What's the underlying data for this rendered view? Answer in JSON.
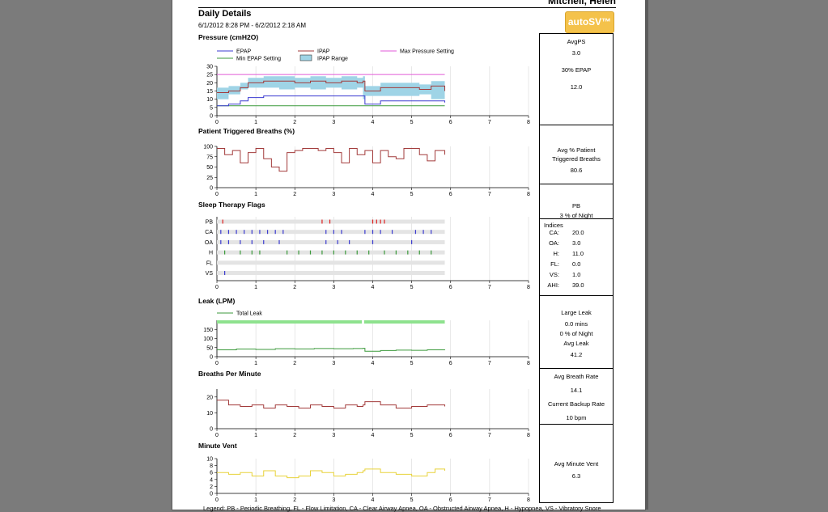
{
  "header": {
    "patient_name": "Mitchell, Helen",
    "title": "Daily Details",
    "date_range": "6/1/2012 8:28 PM - 6/2/2012 2:18 AM",
    "logo_text": "autoSV™"
  },
  "colors": {
    "epap": "#3b3bd0",
    "ipap": "#a23b3b",
    "min_epap": "#3c9a3c",
    "max_pressure": "#e05ad8",
    "ipap_range": "#9fd4e6",
    "flag_pb": "#e02020",
    "flag_ca": "#3b3bd0",
    "flag_oa": "#3b3bd0",
    "flag_h": "#3c9a3c",
    "leak": "#3c9a3c",
    "leak_bar": "#8ee28e",
    "breaths": "#a23b3b",
    "minute_vent": "#e8d23a"
  },
  "sections": {
    "pressure": "Pressure (cmH2O)",
    "triggered": "Patient Triggered Breaths (%)",
    "flags": "Sleep Therapy Flags",
    "leak": "Leak (LPM)",
    "bpm": "Breaths Per Minute",
    "mv": "Minute Vent"
  },
  "side": {
    "pressure": {
      "l1": "AvgPS",
      "v1": "3.0",
      "l2": "30% EPAP",
      "v2": "12.0"
    },
    "triggered": {
      "l1": "Avg % Patient",
      "l2": "Triggered Breaths",
      "v1": "80.6"
    },
    "pb": {
      "l1": "PB",
      "v1": "3 % of Night"
    },
    "indices": {
      "title": "Indices",
      "rows": [
        {
          "k": "CA:",
          "v": "20.0"
        },
        {
          "k": "OA:",
          "v": "3.0"
        },
        {
          "k": "H:",
          "v": "11.0"
        },
        {
          "k": "FL:",
          "v": "0.0"
        },
        {
          "k": "VS:",
          "v": "1.0"
        },
        {
          "k": "AHI:",
          "v": "39.0"
        }
      ]
    },
    "leak": {
      "l1": "Large Leak",
      "v1": "0.0 mins",
      "v2": "0 % of Night",
      "l2": "Avg Leak",
      "v3": "41.2"
    },
    "bpm": {
      "l1": "Avg Breath Rate",
      "v1": "14.1",
      "l2": "Current Backup Rate",
      "v2": "10 bpm"
    },
    "mv": {
      "l1": "Avg Minute Vent",
      "v1": "6.3"
    }
  },
  "footer": "Legend: PB - Periodic Breathing, FL - Flow Limitation, CA - Clear Airway Apnea, OA - Obstructed Airway Apnea, H - Hypopnea, VS - Vibratory Snore",
  "chart_data": [
    {
      "type": "line",
      "title": "Pressure (cmH2O)",
      "x_ticks": [
        "0",
        "1",
        "2",
        "3",
        "4",
        "5",
        "6",
        "7",
        "8"
      ],
      "y_ticks": [
        "0",
        "5",
        "10",
        "15",
        "20",
        "25",
        "30"
      ],
      "xlim": [
        0,
        8
      ],
      "ylim": [
        0,
        30
      ],
      "legend": [
        "EPAP",
        "IPAP",
        "Max Pressure Setting",
        "Min EPAP Setting",
        "IPAP Range"
      ],
      "series": [
        {
          "name": "Max Pressure Setting",
          "x": [
            0,
            5.85
          ],
          "y": [
            25,
            25
          ]
        },
        {
          "name": "Min EPAP Setting",
          "x": [
            0,
            5.85
          ],
          "y": [
            6,
            6
          ]
        },
        {
          "name": "IPAP",
          "x": [
            0,
            0.3,
            0.6,
            0.8,
            1.2,
            1.6,
            2.0,
            2.4,
            2.8,
            3.2,
            3.6,
            3.75,
            3.8,
            4.2,
            4.8,
            5.2,
            5.5,
            5.85
          ],
          "y": [
            14,
            15,
            17,
            20,
            21,
            21,
            20,
            21,
            20,
            21,
            20,
            21,
            15,
            17,
            17,
            16,
            18,
            15
          ]
        },
        {
          "name": "EPAP",
          "x": [
            0,
            0.3,
            0.6,
            0.8,
            1.2,
            1.6,
            2.0,
            2.4,
            2.8,
            3.2,
            3.6,
            3.75,
            3.8,
            4.2,
            4.8,
            5.2,
            5.5,
            5.85
          ],
          "y": [
            6,
            7,
            9,
            11,
            12,
            12,
            12,
            12,
            12,
            12,
            12,
            12,
            7,
            9,
            9,
            9,
            9,
            8
          ]
        }
      ],
      "range_band": {
        "name": "IPAP Range",
        "x": [
          0,
          0.3,
          0.6,
          0.8,
          1.2,
          1.6,
          2.0,
          2.4,
          2.8,
          3.2,
          3.6,
          3.75,
          3.8,
          4.2,
          4.8,
          5.2,
          5.5,
          5.85
        ],
        "low": [
          9,
          10,
          13,
          16,
          17,
          17,
          16,
          17,
          16,
          17,
          16,
          17,
          10,
          12,
          12,
          12,
          13,
          10
        ],
        "high": [
          17,
          18,
          20,
          23,
          24,
          24,
          23,
          24,
          23,
          24,
          23,
          24,
          18,
          20,
          20,
          19,
          21,
          18
        ]
      }
    },
    {
      "type": "line",
      "title": "Patient Triggered Breaths (%)",
      "x_ticks": [
        "0",
        "1",
        "2",
        "3",
        "4",
        "5",
        "6",
        "7",
        "8"
      ],
      "y_ticks": [
        "0",
        "25",
        "50",
        "75",
        "100"
      ],
      "xlim": [
        0,
        8
      ],
      "ylim": [
        0,
        100
      ],
      "series": [
        {
          "name": "Patient Triggered Breaths",
          "x": [
            0,
            0.2,
            0.4,
            0.6,
            0.8,
            1.0,
            1.2,
            1.4,
            1.6,
            1.8,
            2.0,
            2.2,
            2.4,
            2.6,
            2.8,
            3.0,
            3.2,
            3.4,
            3.6,
            3.8,
            4.0,
            4.2,
            4.4,
            4.6,
            4.8,
            5.0,
            5.2,
            5.4,
            5.6,
            5.85
          ],
          "y": [
            95,
            80,
            90,
            60,
            85,
            95,
            70,
            50,
            40,
            85,
            90,
            95,
            95,
            90,
            95,
            85,
            60,
            95,
            80,
            90,
            60,
            90,
            75,
            70,
            95,
            95,
            80,
            65,
            90,
            80
          ]
        }
      ]
    },
    {
      "type": "scatter",
      "title": "Sleep Therapy Flags",
      "x_ticks": [
        "0",
        "1",
        "2",
        "3",
        "4",
        "5",
        "6",
        "7",
        "8"
      ],
      "categories": [
        "PB",
        "CA",
        "OA",
        "H",
        "FL",
        "VS"
      ],
      "xlim": [
        0,
        8
      ],
      "events": {
        "PB": [
          0.15,
          2.7,
          2.9,
          4.0,
          4.1,
          4.2,
          4.3
        ],
        "CA": [
          0.1,
          0.3,
          0.5,
          0.7,
          0.9,
          1.1,
          1.3,
          1.5,
          1.7,
          2.8,
          3.0,
          3.2,
          3.8,
          4.0,
          4.2,
          4.5,
          5.1,
          5.3,
          5.5
        ],
        "OA": [
          0.1,
          0.3,
          0.6,
          0.9,
          1.2,
          1.6,
          2.8,
          3.1,
          3.4,
          4.0,
          5.0
        ],
        "H": [
          0.2,
          0.6,
          0.9,
          1.1,
          1.8,
          2.1,
          2.4,
          2.7,
          3.0,
          3.3,
          3.6,
          3.9,
          4.3,
          4.6,
          4.9,
          5.2,
          5.5
        ],
        "FL": [],
        "VS": [
          0.2
        ]
      }
    },
    {
      "type": "line",
      "title": "Leak (LPM)",
      "x_ticks": [
        "0",
        "1",
        "2",
        "3",
        "4",
        "5",
        "6",
        "7",
        "8"
      ],
      "y_ticks": [
        "0",
        "50",
        "100",
        "150"
      ],
      "xlim": [
        0,
        8
      ],
      "ylim": [
        0,
        200
      ],
      "legend": [
        "Total Leak"
      ],
      "series": [
        {
          "name": "Total Leak",
          "x": [
            0,
            0.5,
            1.0,
            1.5,
            2.0,
            2.5,
            3.0,
            3.5,
            3.75,
            3.8,
            4.2,
            4.6,
            5.0,
            5.4,
            5.85
          ],
          "y": [
            38,
            42,
            40,
            44,
            43,
            45,
            44,
            45,
            46,
            30,
            34,
            36,
            35,
            38,
            36
          ]
        }
      ]
    },
    {
      "type": "line",
      "title": "Breaths Per Minute",
      "x_ticks": [
        "0",
        "1",
        "2",
        "3",
        "4",
        "5",
        "6",
        "7",
        "8"
      ],
      "y_ticks": [
        "0",
        "10",
        "20"
      ],
      "xlim": [
        0,
        8
      ],
      "ylim": [
        0,
        25
      ],
      "series": [
        {
          "name": "Breaths Per Minute",
          "x": [
            0,
            0.3,
            0.6,
            0.9,
            1.2,
            1.5,
            1.8,
            2.1,
            2.4,
            2.7,
            3.0,
            3.3,
            3.6,
            3.75,
            3.8,
            4.2,
            4.6,
            5.0,
            5.4,
            5.85
          ],
          "y": [
            18,
            15,
            14,
            15,
            13,
            15,
            14,
            13,
            15,
            14,
            13,
            15,
            14,
            15,
            17,
            15,
            13,
            14,
            15,
            14
          ]
        }
      ]
    },
    {
      "type": "line",
      "title": "Minute Vent",
      "x_ticks": [
        "0",
        "1",
        "2",
        "3",
        "4",
        "5",
        "6",
        "7",
        "8"
      ],
      "y_ticks": [
        "0",
        "2",
        "4",
        "6",
        "8",
        "10"
      ],
      "xlim": [
        0,
        8
      ],
      "ylim": [
        0,
        10
      ],
      "series": [
        {
          "name": "Minute Vent",
          "x": [
            0,
            0.3,
            0.6,
            0.9,
            1.2,
            1.5,
            1.8,
            2.1,
            2.4,
            2.7,
            3.0,
            3.3,
            3.6,
            3.75,
            3.8,
            4.2,
            4.6,
            5.0,
            5.4,
            5.6,
            5.85
          ],
          "y": [
            6,
            5.5,
            6,
            5,
            6.5,
            5,
            4.5,
            5,
            6.5,
            6,
            5,
            5.5,
            6,
            6.5,
            7,
            6,
            5.5,
            5,
            6,
            7,
            6.5
          ]
        }
      ]
    }
  ]
}
